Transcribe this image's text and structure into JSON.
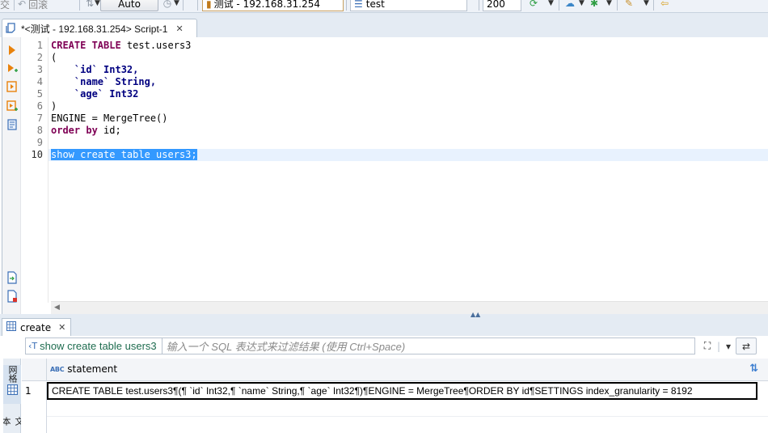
{
  "toolbar": {
    "commit_label": "交",
    "rollback_label": "回滚",
    "tx_mode": "Auto",
    "connection": "测试 - 192.168.31.254",
    "database": "test",
    "limit": "200"
  },
  "editor_tab": {
    "title": "*<测试 - 192.168.31.254> Script-1"
  },
  "editor": {
    "line_numbers": [
      "1",
      "2",
      "3",
      "4",
      "5",
      "6",
      "7",
      "8",
      "9",
      "10"
    ],
    "lines": {
      "l1_kw": "CREATE TABLE",
      "l1_rest": " test.users3",
      "l2": "(",
      "l3_indent": "    ",
      "l3_name": "`id`",
      "l3_type": " Int32,",
      "l4_indent": "    ",
      "l4_name": "`name`",
      "l4_type": " String,",
      "l5_indent": "    ",
      "l5_name": "`age`",
      "l5_type": " Int32",
      "l6": ")",
      "l7": "ENGINE = MergeTree()",
      "l8_kw": "order by",
      "l8_rest": " id;",
      "l10": "show create table users3;"
    }
  },
  "results": {
    "tab_label": "create",
    "filter_query": "show create table users3",
    "filter_placeholder": "输入一个 SQL 表达式来过滤结果 (使用 Ctrl+Space)",
    "side_tab_grid": "网格",
    "side_tab_text": "文本",
    "column_type_badge": "ABC",
    "columns": [
      "statement"
    ],
    "rows": [
      {
        "num": "1",
        "statement": "CREATE TABLE test.users3¶(¶    `id` Int32,¶    `name` String,¶    `age` Int32¶)¶ENGINE = MergeTree¶ORDER BY id¶SETTINGS index_granularity = 8192"
      }
    ]
  },
  "colors": {
    "keyword": "#7f0055",
    "identifier": "#000080",
    "selection": "#3399ff",
    "current_line": "#e8f2fe",
    "panel_bg": "#e4ebf3"
  }
}
